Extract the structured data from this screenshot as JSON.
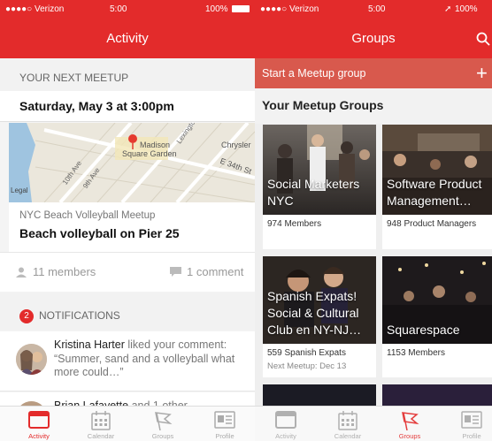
{
  "left": {
    "status": {
      "carrier": "●●●●○ Verizon",
      "time": "5:00",
      "battery": "100%"
    },
    "title": "Activity",
    "next_meetup_header": "YOUR NEXT MEETUP",
    "meetup_date": "Saturday, May 3 at 3:00pm",
    "map_labels": {
      "venue": "Madison Square Garden",
      "venue_line1": "Madison",
      "venue_line2": "Square Garden",
      "chrysler": "Chrysler",
      "street1": "E 34th St",
      "ave1": "10th Ave",
      "ave2": "9th Ave",
      "ave3": "Lexington",
      "legal": "Legal"
    },
    "meetup_group": "NYC Beach Volleyball Meetup",
    "meetup_title": "Beach volleyball on Pier 25",
    "members": "11 members",
    "comments": "1 comment",
    "notifications_header": "NOTIFICATIONS",
    "notifications_count": "2",
    "notifications": [
      {
        "name": "Kristina Harter",
        "rest": " liked your comment: “Summer, sand and a volleyball what more could…”"
      },
      {
        "name": "Brian Lafayette",
        "rest": " and 1 other"
      }
    ]
  },
  "right": {
    "status": {
      "carrier": "●●●●○ Verizon",
      "time": "5:00",
      "battery": "100%"
    },
    "title": "Groups",
    "start_group": "Start a Meetup group",
    "groups_header": "Your Meetup Groups",
    "groups": [
      {
        "name": "Social Marketers NYC",
        "members": "974 Members",
        "next": ""
      },
      {
        "name": "Software Product Management…",
        "members": "948 Product Managers",
        "next": ""
      },
      {
        "name": "Spanish Expats! Social & Cultural Club en NY-NJ…",
        "members": "559 Spanish Expats",
        "next": "Next Meetup: Dec 13"
      },
      {
        "name": "Squarespace",
        "members": "1153 Members",
        "next": ""
      }
    ]
  },
  "tabs": [
    "Activity",
    "Calendar",
    "Groups",
    "Profile"
  ],
  "colors": {
    "brand": "#e32b2b",
    "start_bar": "#d8594d"
  }
}
